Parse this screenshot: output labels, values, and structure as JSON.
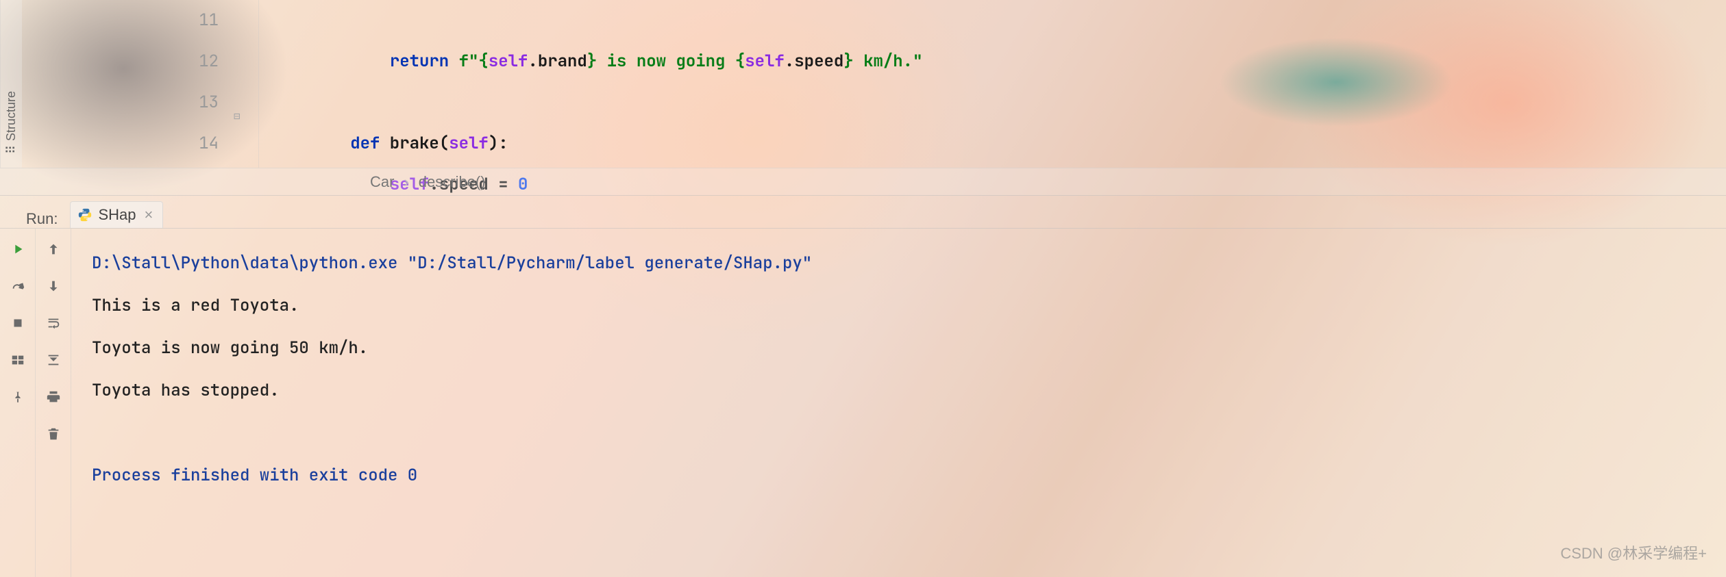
{
  "sidebar": {
    "structure_label": "Structure"
  },
  "editor": {
    "lines": [
      {
        "num": "11"
      },
      {
        "num": "12"
      },
      {
        "num": "13"
      },
      {
        "num": "14"
      }
    ],
    "line11_return": "return",
    "line11_fprefix": " f\"",
    "line11_lbrace": "{",
    "line11_self1": "self",
    "line11_brand": ".brand",
    "line11_rbrace1": "}",
    "line11_mid": " is now going ",
    "line11_lbrace2": "{",
    "line11_self2": "self",
    "line11_speed": ".speed",
    "line11_rbrace2": "}",
    "line11_tail": " km/h.\"",
    "line13_def": "def",
    "line13_name": " brake",
    "line13_open": "(",
    "line13_self": "self",
    "line13_close": "):",
    "line14_self": "self",
    "line14_attr": ".speed = ",
    "line14_val": "0"
  },
  "breadcrumb": {
    "class": "Car",
    "method": "describe()"
  },
  "run": {
    "label": "Run:",
    "tab_name": "SHap",
    "command": "D:\\Stall\\Python\\data\\python.exe \"D:/Stall/Pycharm/label generate/SHap.py\"",
    "output": [
      "This is a red Toyota.",
      "Toyota is now going 50 km/h.",
      "Toyota has stopped."
    ],
    "exit": "Process finished with exit code 0"
  },
  "watermark": "CSDN @林采学编程+"
}
